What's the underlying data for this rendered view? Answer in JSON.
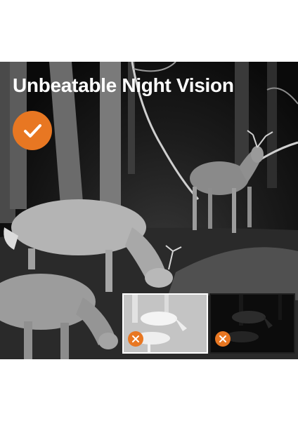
{
  "banner": {
    "title": "Unbeatable Night Vision",
    "accent_color": "#e87722",
    "badge_icon": "checkmark-icon",
    "comparisons": [
      {
        "icon": "cross-icon",
        "style": "overexposed"
      },
      {
        "icon": "cross-icon",
        "style": "underexposed"
      }
    ]
  }
}
